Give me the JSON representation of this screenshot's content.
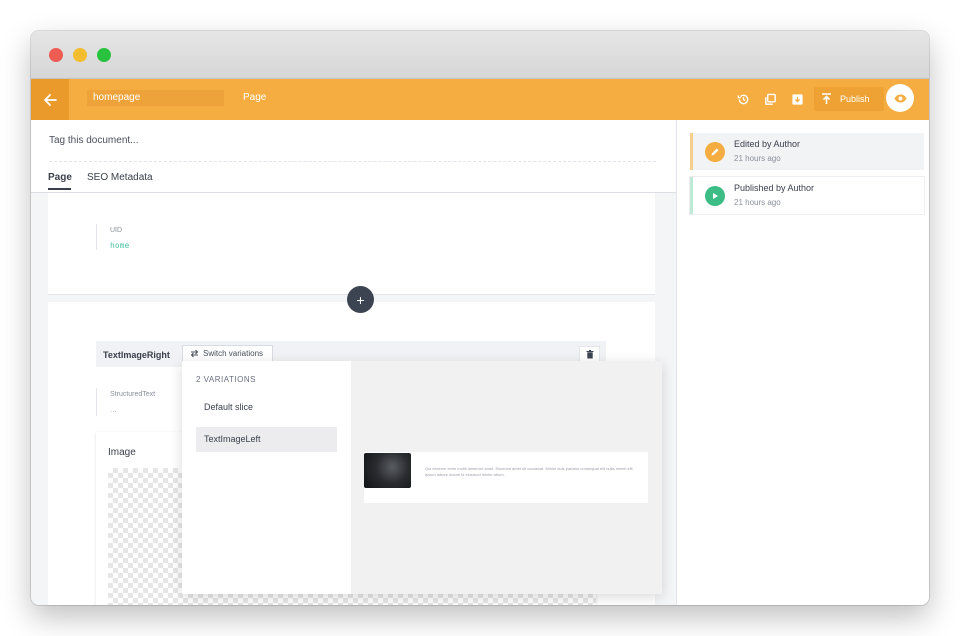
{
  "window": {
    "controls": [
      "close",
      "minimize",
      "maximize"
    ]
  },
  "topbar": {
    "back_icon": "arrow-left-icon",
    "doc_name": "homepage",
    "doc_type": "Page",
    "icons": [
      "history-icon",
      "duplicate-icon",
      "archive-icon"
    ],
    "publish_label": "Publish",
    "preview_icon": "eye-icon",
    "accent": "#f5ac40"
  },
  "editor": {
    "tag_placeholder": "Tag this document...",
    "tabs": [
      {
        "label": "Page",
        "active": true
      },
      {
        "label": "SEO Metadata",
        "active": false
      }
    ],
    "uid_field": {
      "label": "UID",
      "value": "home"
    },
    "add_slice_label": "+",
    "slice": {
      "name": "TextImageRight",
      "switch_label": "Switch variations",
      "structured_text_label": "StructuredText",
      "structured_text_value": "...",
      "image_label": "Image"
    },
    "variations": {
      "title": "2 VARIATIONS",
      "items": [
        {
          "label": "Default slice",
          "selected": false
        },
        {
          "label": "TextImageLeft",
          "selected": true
        }
      ],
      "preview_text": "Qui excerce enim mollit deserunt amet. Eiusmod amet sit occaecat. Minim duis pariatur consequat elit nulla minim elit ipsum labore dolore id eiusmod minim cillum."
    }
  },
  "history": [
    {
      "label": "Edited by Author",
      "time": "21 hours ago",
      "icon": "pencil-icon",
      "color": "#f5ac40"
    },
    {
      "label": "Published by Author",
      "time": "21 hours ago",
      "icon": "play-icon",
      "color": "#3dbd86"
    }
  ]
}
